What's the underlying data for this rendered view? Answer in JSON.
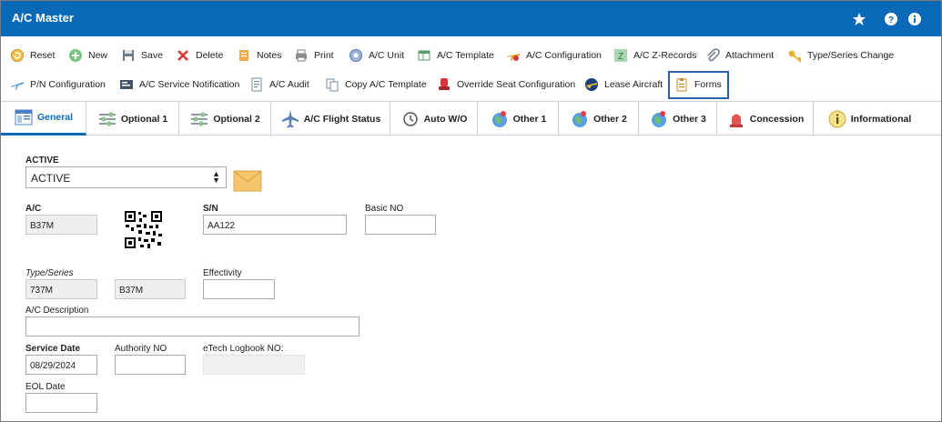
{
  "window": {
    "title": "A/C Master"
  },
  "title_icons": [
    "star-icon",
    "help-icon",
    "info-icon"
  ],
  "toolbar": {
    "row1": [
      {
        "label": "Reset",
        "icon": "reset-icon"
      },
      {
        "label": "New",
        "icon": "new-icon"
      },
      {
        "label": "Save",
        "icon": "save-icon"
      },
      {
        "label": "Delete",
        "icon": "delete-icon"
      },
      {
        "label": "Notes",
        "icon": "notes-icon"
      },
      {
        "label": "Print",
        "icon": "print-icon"
      },
      {
        "label": "A/C Unit",
        "icon": "unit-icon"
      },
      {
        "label": "A/C Template",
        "icon": "template-icon"
      },
      {
        "label": "A/C Configuration",
        "icon": "configuration-icon"
      },
      {
        "label": "A/C Z-Records",
        "icon": "z-records-icon"
      },
      {
        "label": "Attachment",
        "icon": "paperclip-icon"
      },
      {
        "label": "Type/Series Change",
        "icon": "key-icon"
      }
    ],
    "row2": [
      {
        "label": "P/N Configuration",
        "icon": "pn-configuration-icon"
      },
      {
        "label": "A/C Service Notification",
        "icon": "service-notification-icon"
      },
      {
        "label": "A/C Audit",
        "icon": "audit-icon"
      },
      {
        "label": "Copy A/C Template",
        "icon": "copy-icon"
      },
      {
        "label": "Override Seat Configuration",
        "icon": "seat-icon"
      },
      {
        "label": "Lease Aircraft",
        "icon": "lease-icon"
      },
      {
        "label": "Forms",
        "icon": "forms-icon"
      }
    ]
  },
  "tabs": [
    {
      "label": "General",
      "icon": "general-icon",
      "active": true
    },
    {
      "label": "Optional 1",
      "icon": "sliders-icon"
    },
    {
      "label": "Optional 2",
      "icon": "sliders-icon"
    },
    {
      "label": "A/C Flight Status",
      "icon": "airplane-icon"
    },
    {
      "label": "Auto W/O",
      "icon": "auto-wo-icon"
    },
    {
      "label": "Other 1",
      "icon": "globe-icon"
    },
    {
      "label": "Other 2",
      "icon": "globe-icon"
    },
    {
      "label": "Other 3",
      "icon": "globe-icon"
    },
    {
      "label": "Concession",
      "icon": "siren-icon"
    },
    {
      "label": "Informational",
      "icon": "info-circle-icon"
    }
  ],
  "form": {
    "active_label": "ACTIVE",
    "active_value": "ACTIVE",
    "ac_label": "A/C",
    "ac_value": "B37M",
    "sn_label": "S/N",
    "sn_value": "AA122",
    "basic_no_label": "Basic NO",
    "basic_no_value": "",
    "type_series_label": "Type/Series",
    "type_value": "737M",
    "series_value": "B37M",
    "effectivity_label": "Effectivity",
    "effectivity_value": "",
    "description_label": "A/C Description",
    "description_value": "",
    "service_date_label": "Service Date",
    "service_date_value": "08/29/2024",
    "authority_no_label": "Authority NO",
    "authority_no_value": "",
    "etech_label": "eTech Logbook NO:",
    "etech_value": "",
    "eol_date_label": "EOL Date",
    "eol_date_value": ""
  },
  "colors": {
    "accent": "#0a6ab8",
    "highlight_border": "#2c5fa4"
  }
}
